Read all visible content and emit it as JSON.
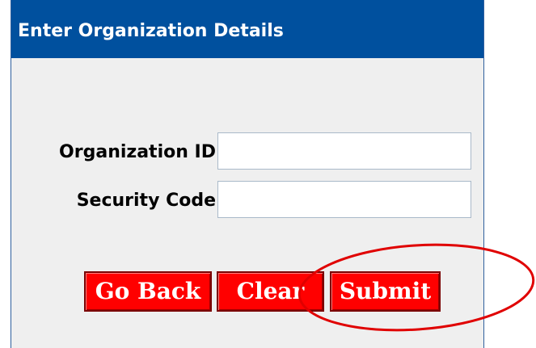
{
  "header": {
    "title": "Enter Organization Details"
  },
  "form": {
    "org_id": {
      "label": "Organization ID",
      "value": ""
    },
    "security_code": {
      "label": "Security Code",
      "value": ""
    }
  },
  "buttons": {
    "go_back": "Go Back",
    "clear": "Clear",
    "submit": "Submit"
  },
  "colors": {
    "header_bg": "#00509e",
    "panel_bg": "#efefef",
    "button_bg": "#ff0000",
    "annotation_ring": "#e00000"
  },
  "annotation": {
    "shape": "ellipse",
    "target": "submit-button"
  }
}
